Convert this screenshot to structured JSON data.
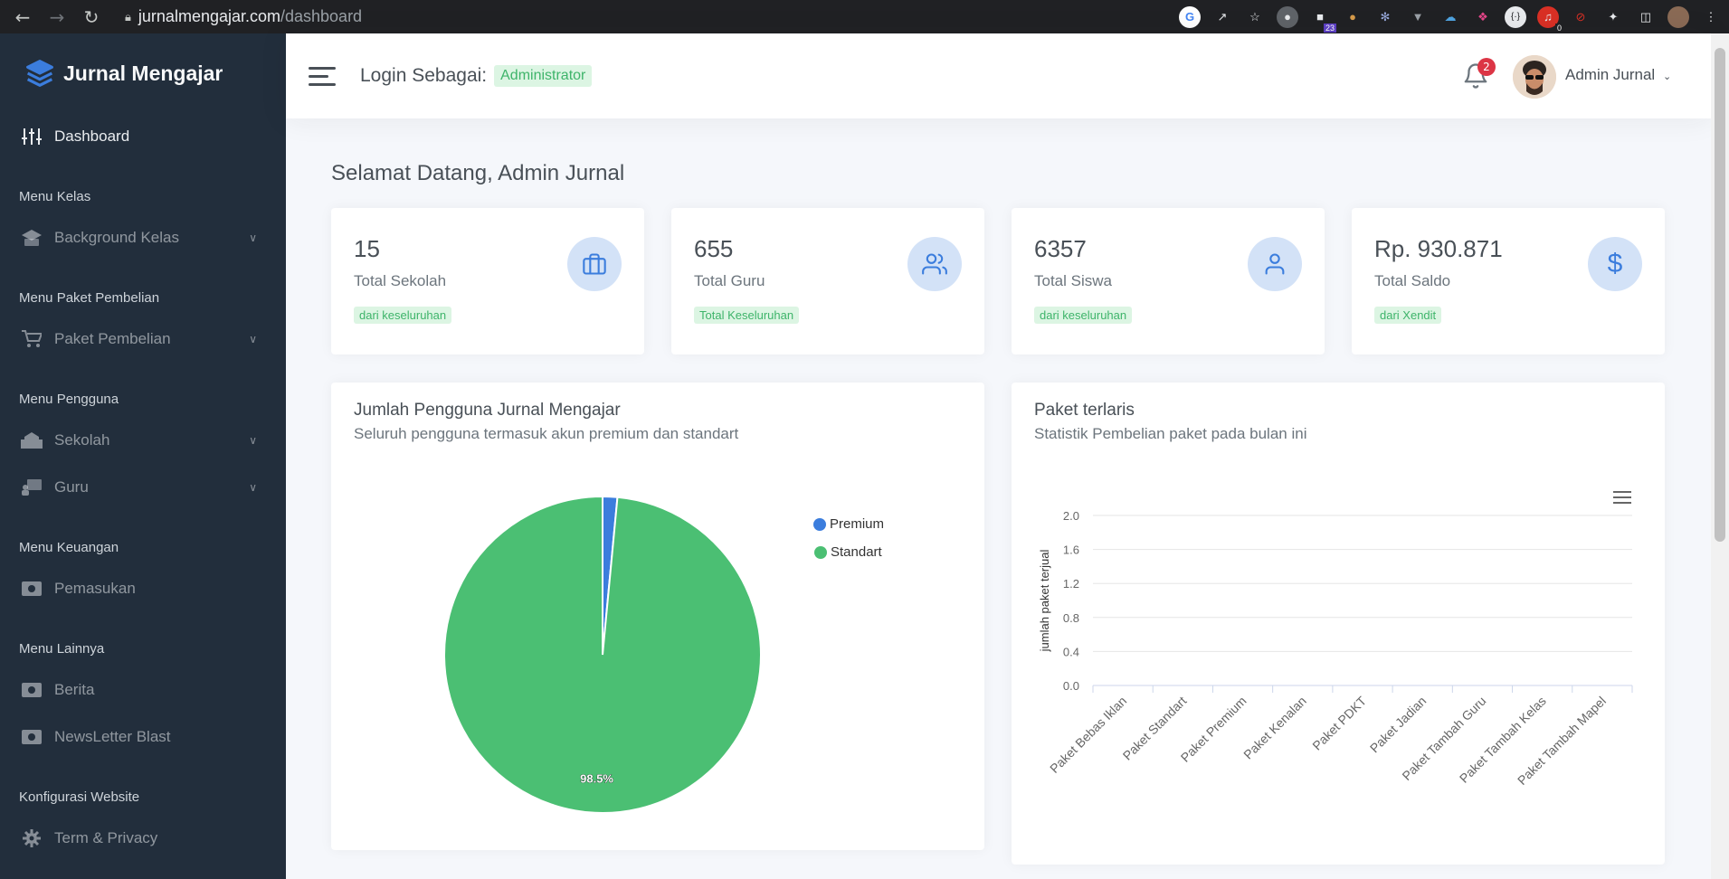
{
  "browser": {
    "url_host": "jurnalmengajar.com",
    "url_path": "/dashboard",
    "extension_badges": {
      "calendar": "23",
      "pdf": "0"
    }
  },
  "sidebar": {
    "brand": "Jurnal Mengajar",
    "dashboard_label": "Dashboard",
    "sections": [
      {
        "header": "Menu Kelas",
        "items": [
          {
            "label": "Background Kelas",
            "icon": "class-icon",
            "has_submenu": true
          }
        ]
      },
      {
        "header": "Menu Paket Pembelian",
        "items": [
          {
            "label": "Paket Pembelian",
            "icon": "cart-icon",
            "has_submenu": true
          }
        ]
      },
      {
        "header": "Menu Pengguna",
        "items": [
          {
            "label": "Sekolah",
            "icon": "school-icon",
            "has_submenu": true
          },
          {
            "label": "Guru",
            "icon": "teacher-icon",
            "has_submenu": true
          }
        ]
      },
      {
        "header": "Menu Keuangan",
        "items": [
          {
            "label": "Pemasukan",
            "icon": "money-icon",
            "has_submenu": false
          }
        ]
      },
      {
        "header": "Menu Lainnya",
        "items": [
          {
            "label": "Berita",
            "icon": "money-icon",
            "has_submenu": false
          },
          {
            "label": "NewsLetter Blast",
            "icon": "money-icon",
            "has_submenu": false
          }
        ]
      },
      {
        "header": "Konfigurasi Website",
        "items": [
          {
            "label": "Term & Privacy",
            "icon": "gear-icon",
            "has_submenu": false
          }
        ]
      }
    ]
  },
  "topbar": {
    "login_label": "Login Sebagai:",
    "role": "Administrator",
    "notification_count": "2",
    "user_name": "Admin Jurnal"
  },
  "main": {
    "welcome": "Selamat Datang, Admin Jurnal",
    "stats": [
      {
        "value": "15",
        "label": "Total Sekolah",
        "badge": "dari keseluruhan",
        "icon": "briefcase-icon"
      },
      {
        "value": "655",
        "label": "Total Guru",
        "badge": "Total Keseluruhan",
        "icon": "users-icon"
      },
      {
        "value": "6357",
        "label": "Total Siswa",
        "badge": "dari keseluruhan",
        "icon": "user-icon"
      },
      {
        "value": "Rp. 930.871",
        "label": "Total Saldo",
        "badge": "dari Xendit",
        "icon": "dollar-icon"
      }
    ],
    "users_panel": {
      "title": "Jumlah Pengguna Jurnal Mengajar",
      "subtitle": "Seluruh pengguna termasuk akun premium dan standart"
    },
    "packages_panel": {
      "title": "Paket terlaris",
      "subtitle": "Statistik Pembelian paket pada bulan ini"
    }
  },
  "chart_data": [
    {
      "type": "pie",
      "categories": [
        "Premium",
        "Standart"
      ],
      "values": [
        1.5,
        98.5
      ],
      "data_labels": [
        "",
        "98.5%"
      ],
      "colors": [
        "#3b7ddd",
        "#4bbf73"
      ],
      "legend_position": "top-right"
    },
    {
      "type": "bar",
      "categories": [
        "Paket Bebas Iklan",
        "Paket Standart",
        "Paket Premium",
        "Paket Kenalan",
        "Paket PDKT",
        "Paket Jadian",
        "Paket Tambah Guru",
        "Paket Tambah Kelas",
        "Paket Tambah Mapel"
      ],
      "values": [
        0,
        0,
        0,
        0,
        0,
        0,
        0,
        0,
        0
      ],
      "ylabel": "jumlah paket terjual",
      "ylim": [
        0,
        2
      ],
      "yticks": [
        "0.0",
        "0.4",
        "0.8",
        "1.2",
        "1.6",
        "2.0"
      ],
      "grid": true,
      "menu_icon": "hamburger-menu-icon"
    }
  ]
}
